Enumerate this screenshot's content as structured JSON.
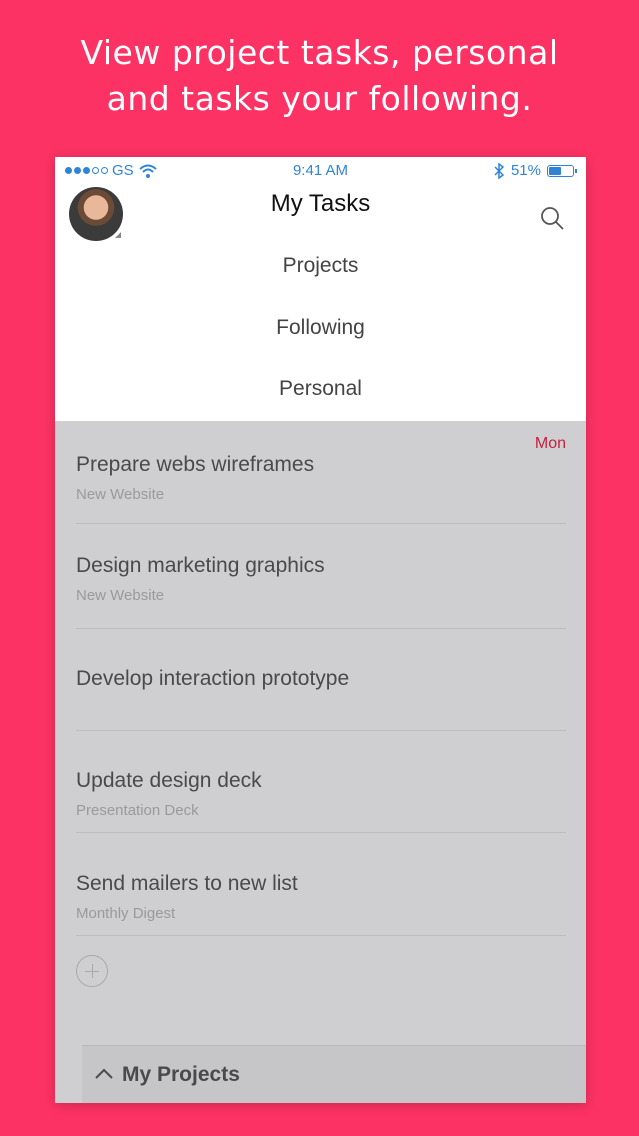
{
  "headline": {
    "line1": "View project tasks, personal",
    "line2": "and tasks your following."
  },
  "status_bar": {
    "carrier": "GS",
    "time": "9:41 AM",
    "battery": "51%",
    "battery_level": 0.51,
    "signal_dots_filled": 3,
    "signal_dots_total": 5
  },
  "header": {
    "title": "My Tasks",
    "avatar_icon": "user-avatar",
    "search_icon": "search-icon"
  },
  "menu": {
    "items": [
      "Projects",
      "Following",
      "Personal"
    ]
  },
  "tasks": [
    {
      "title": "Prepare webs wireframes",
      "subtitle": "New Website",
      "due": "Mon"
    },
    {
      "title": "Design marketing graphics",
      "subtitle": "New Website"
    },
    {
      "title": "Develop interaction prototype",
      "subtitle": ""
    },
    {
      "title": "Update design deck",
      "subtitle": "Presentation Deck"
    },
    {
      "title": "Send mailers to new list",
      "subtitle": "Monthly Digest"
    }
  ],
  "add_icon": "plus-circle-icon",
  "bottom_bar": {
    "label": "My Projects",
    "icon": "chevron-up-icon"
  },
  "colors": {
    "background": "#fb3263",
    "status_blue": "#2f84d8",
    "due_red": "#c2223f"
  }
}
